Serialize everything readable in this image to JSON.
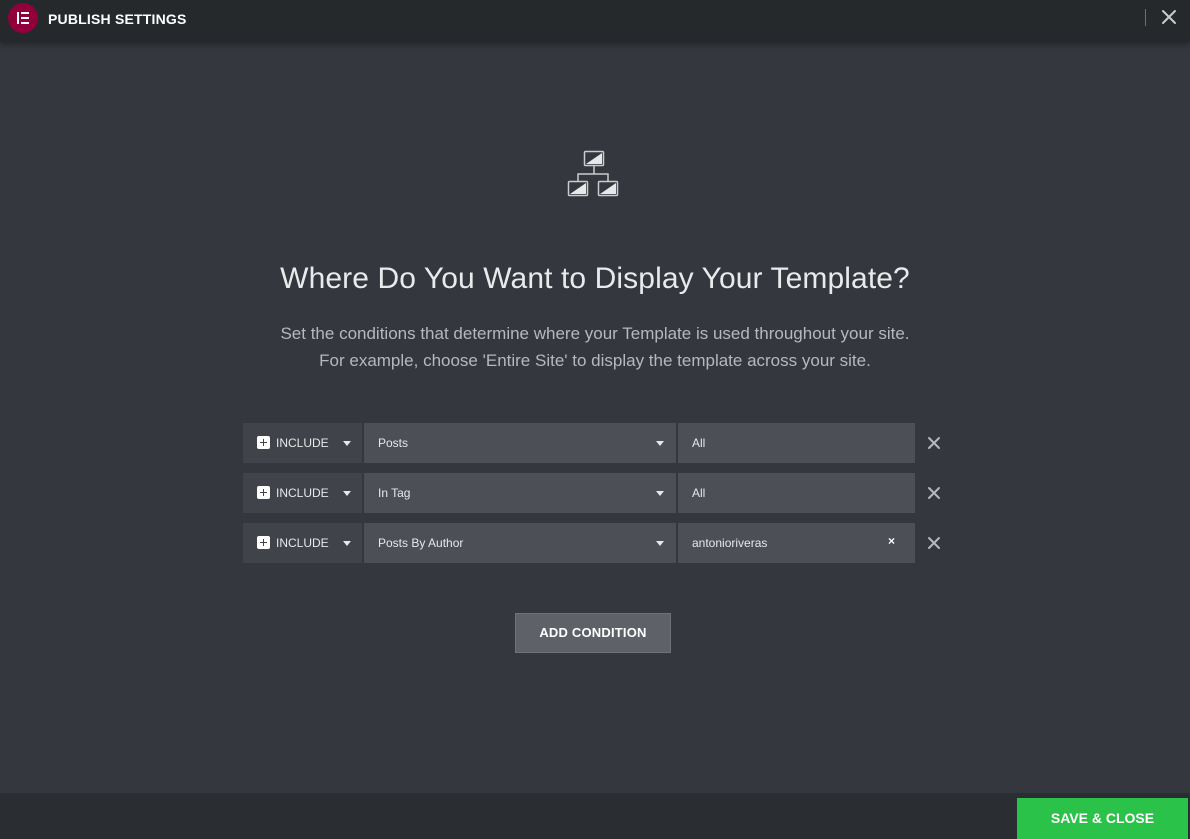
{
  "header": {
    "title": "PUBLISH SETTINGS"
  },
  "main": {
    "title": "Where Do You Want to Display Your Template?",
    "description_line1": "Set the conditions that determine where your Template is used throughout your site.",
    "description_line2": "For example, choose 'Entire Site' to display the template across your site."
  },
  "conditions": [
    {
      "type": "INCLUDE",
      "main": "Posts",
      "sub": "All",
      "clearable": false
    },
    {
      "type": "INCLUDE",
      "main": "In Tag",
      "sub": "All",
      "clearable": false
    },
    {
      "type": "INCLUDE",
      "main": "Posts By Author",
      "sub": "antonioriveras",
      "clearable": true
    }
  ],
  "buttons": {
    "add_condition": "ADD CONDITION",
    "save_close": "SAVE & CLOSE"
  },
  "icons": {
    "logo": "elementor-logo-icon",
    "close": "close-icon",
    "hero": "sitemap-icon",
    "include": "plus-square-icon",
    "remove": "close-icon",
    "dropdown": "caret-down-icon"
  },
  "colors": {
    "header_bg": "#26292c",
    "body_bg": "#34373d",
    "logo_bg": "#92003b",
    "save_bg": "#2bc24a",
    "field_bg": "#4c4f56",
    "type_bg": "#404349"
  }
}
